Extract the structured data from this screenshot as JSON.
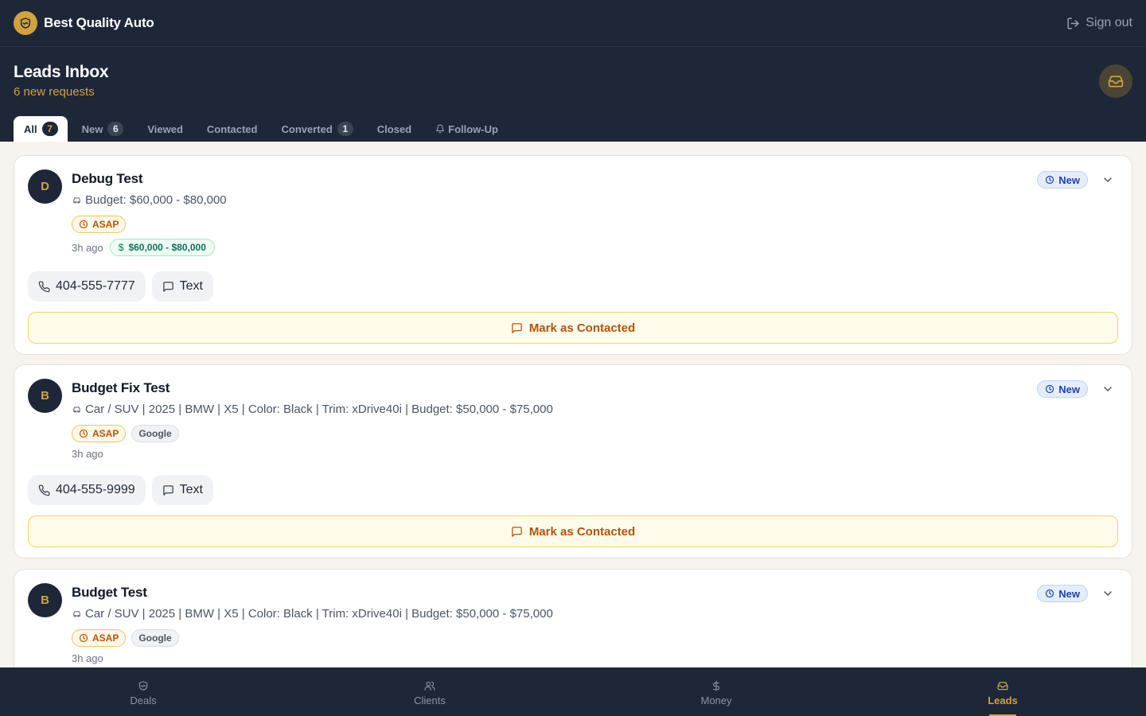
{
  "app": {
    "brand": "Best Quality Auto",
    "signout_label": "Sign out"
  },
  "header": {
    "title": "Leads Inbox",
    "subtitle": "6 new requests"
  },
  "tabs": [
    {
      "label": "All",
      "count": "7"
    },
    {
      "label": "New",
      "count": "6"
    },
    {
      "label": "Viewed"
    },
    {
      "label": "Contacted"
    },
    {
      "label": "Converted",
      "count": "1"
    },
    {
      "label": "Closed"
    },
    {
      "label": "Follow-Up"
    }
  ],
  "leads": [
    {
      "initial": "D",
      "name": "Debug Test",
      "description": "Budget: $60,000 - $80,000",
      "urgency": "ASAP",
      "time": "3h ago",
      "budget_pill": "$60,000 - $80,000",
      "status": "New",
      "phone": "404-555-7777",
      "text_label": "Text",
      "mark_label": "Mark as Contacted"
    },
    {
      "initial": "B",
      "name": "Budget Fix Test",
      "description": "Car / SUV | 2025 | BMW | X5 | Color: Black | Trim: xDrive40i | Budget: $50,000 - $75,000",
      "urgency": "ASAP",
      "source": "Google",
      "time": "3h ago",
      "status": "New",
      "phone": "404-555-9999",
      "text_label": "Text",
      "mark_label": "Mark as Contacted"
    },
    {
      "initial": "B",
      "name": "Budget Test",
      "description": "Car / SUV | 2025 | BMW | X5 | Color: Black | Trim: xDrive40i | Budget: $50,000 - $75,000",
      "urgency": "ASAP",
      "source": "Google",
      "time": "3h ago",
      "status": "New"
    }
  ],
  "nav": [
    {
      "label": "Deals",
      "icon": "handshake-icon"
    },
    {
      "label": "Clients",
      "icon": "users-icon"
    },
    {
      "label": "Money",
      "icon": "dollar-icon"
    },
    {
      "label": "Leads",
      "icon": "inbox-icon",
      "active": true
    }
  ],
  "colors": {
    "navy": "#1d2738",
    "gold": "#d4a13b",
    "background": "#f7f4ef"
  }
}
